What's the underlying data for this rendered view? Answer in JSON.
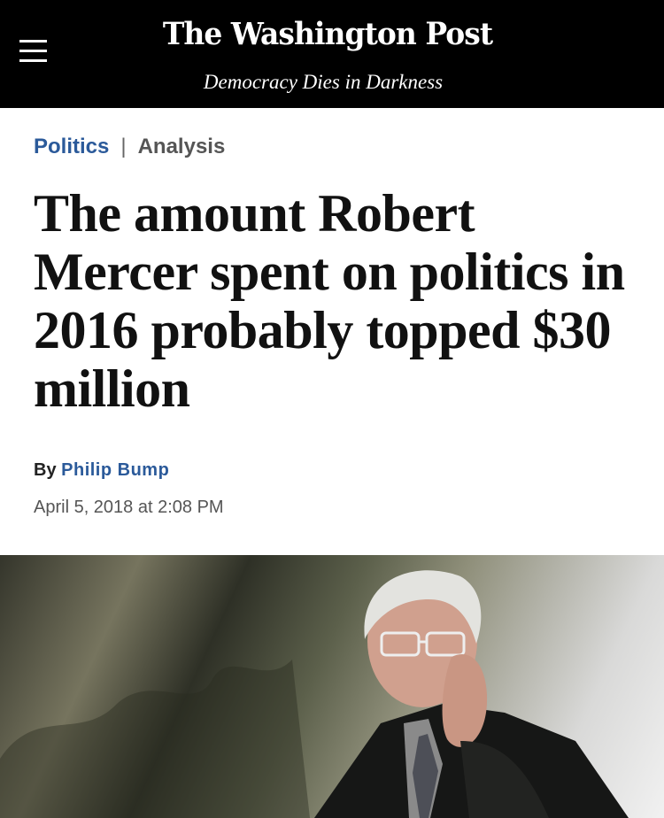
{
  "header": {
    "logo": "The Washington Post",
    "tagline": "Democracy Dies in Darkness"
  },
  "article": {
    "section": "Politics",
    "separator": "|",
    "label": "Analysis",
    "headline": "The amount Robert Mercer spent on politics in 2016 probably topped $30 million",
    "byline_prefix": "By",
    "author": "Philip Bump",
    "timestamp": "April 5, 2018 at 2:08 PM"
  },
  "icons": {
    "menu": "hamburger-menu-icon"
  }
}
